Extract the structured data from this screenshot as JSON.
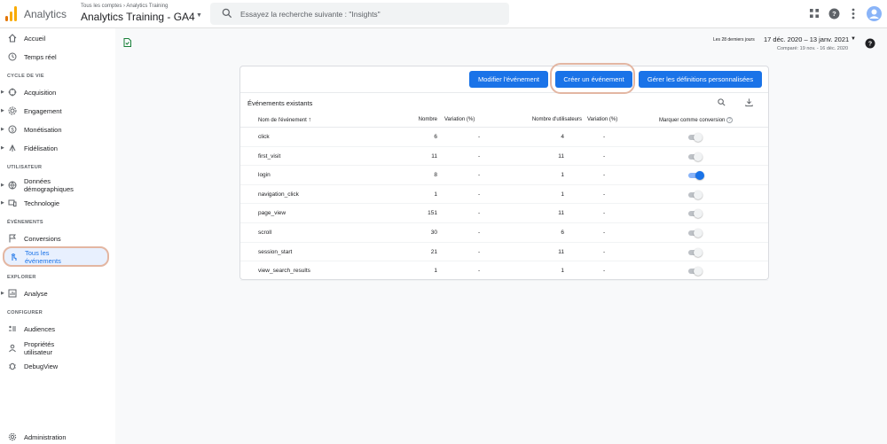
{
  "header": {
    "app_name": "Analytics",
    "account_crumb": "Tous les comptes › Analytics Training",
    "property_name": "Analytics Training - GA4",
    "search_placeholder": "Essayez la recherche suivante : \"Insights\""
  },
  "sidebar": {
    "items": [
      {
        "label": "Accueil",
        "icon": "home-icon"
      },
      {
        "label": "Temps réel",
        "icon": "clock-icon"
      }
    ],
    "section_lifecycle": "CYCLE DE VIE",
    "lifecycle": [
      {
        "label": "Acquisition",
        "icon": "acquisition-icon"
      },
      {
        "label": "Engagement",
        "icon": "engagement-icon"
      },
      {
        "label": "Monétisation",
        "icon": "dollar-icon"
      },
      {
        "label": "Fidélisation",
        "icon": "retention-icon"
      }
    ],
    "section_user": "UTILISATEUR",
    "user": [
      {
        "label": "Données démographiques",
        "line1": "Données",
        "line2": "démographiques",
        "icon": "globe-icon"
      },
      {
        "label": "Technologie",
        "icon": "devices-icon"
      }
    ],
    "section_events": "ÉVÉNEMENTS",
    "events": [
      {
        "label": "Conversions",
        "icon": "flag-icon"
      },
      {
        "label": "Tous les événements",
        "line1": "Tous les",
        "line2": "événements",
        "icon": "touch-icon"
      }
    ],
    "section_explore": "EXPLORER",
    "explore": [
      {
        "label": "Analyse",
        "icon": "analysis-icon"
      }
    ],
    "section_configure": "CONFIGURER",
    "configure": [
      {
        "label": "Audiences",
        "icon": "audiences-icon"
      },
      {
        "label": "Propriétés utilisateur",
        "line1": "Propriétés",
        "line2": "utilisateur",
        "icon": "user-properties-icon"
      },
      {
        "label": "DebugView",
        "icon": "debug-icon"
      }
    ],
    "admin": "Administration"
  },
  "date_range": {
    "prefix": "Les 28 derniers jours",
    "range": "17 déc. 2020 – 13 janv. 2021",
    "compare": "Comparé: 19 nov. - 16 déc. 2020"
  },
  "toolbar": {
    "modify_label": "Modifier l'événement",
    "create_label": "Créer un événement",
    "manage_label": "Gérer les définitions personnalisées"
  },
  "table": {
    "title": "Événements existants",
    "headers": {
      "name": "Nom de l'événement",
      "count": "Nombre",
      "count_change": "Variation (%)",
      "users": "Nombre d'utilisateurs",
      "users_change": "Variation (%)",
      "conversion": "Marquer comme conversion"
    },
    "rows": [
      {
        "name": "click",
        "count": "6",
        "count_change": "-",
        "users": "4",
        "users_change": "-",
        "conversion": false
      },
      {
        "name": "first_visit",
        "count": "11",
        "count_change": "-",
        "users": "11",
        "users_change": "-",
        "conversion": false
      },
      {
        "name": "login",
        "count": "8",
        "count_change": "-",
        "users": "1",
        "users_change": "-",
        "conversion": true
      },
      {
        "name": "navigation_click",
        "count": "1",
        "count_change": "-",
        "users": "1",
        "users_change": "-",
        "conversion": false
      },
      {
        "name": "page_view",
        "count": "151",
        "count_change": "-",
        "users": "11",
        "users_change": "-",
        "conversion": false
      },
      {
        "name": "scroll",
        "count": "30",
        "count_change": "-",
        "users": "6",
        "users_change": "-",
        "conversion": false
      },
      {
        "name": "session_start",
        "count": "21",
        "count_change": "-",
        "users": "11",
        "users_change": "-",
        "conversion": false
      },
      {
        "name": "view_search_results",
        "count": "1",
        "count_change": "-",
        "users": "1",
        "users_change": "-",
        "conversion": false
      }
    ]
  },
  "colors": {
    "primary": "#1a73e8",
    "highlight_ring": "#e3b6a2",
    "logo_orange": "#f9ab00",
    "logo_dark": "#e37400"
  }
}
